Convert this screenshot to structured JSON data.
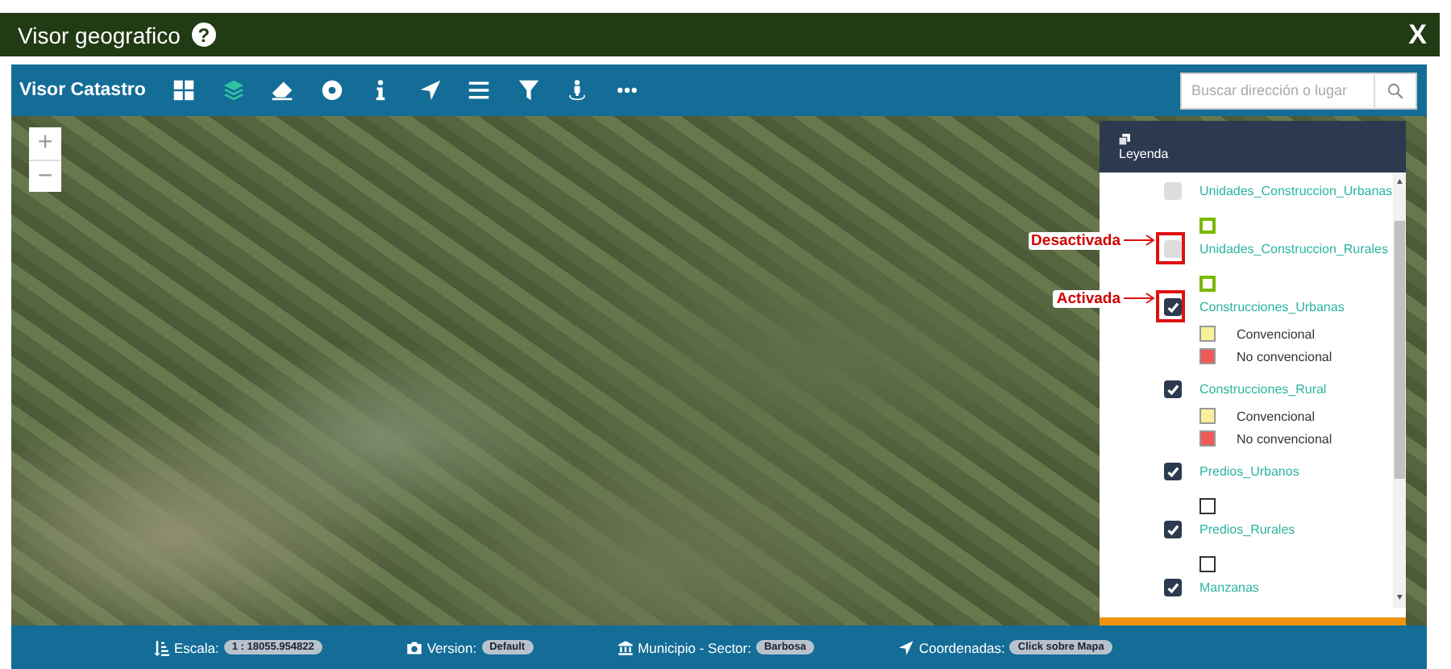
{
  "window": {
    "title": "Visor geografico",
    "help": "?",
    "close": "X"
  },
  "toolbar": {
    "title": "Visor Catastro",
    "tools": [
      {
        "kind": "grid",
        "selected": false
      },
      {
        "kind": "layers",
        "selected": true
      },
      {
        "kind": "eraser",
        "selected": false
      },
      {
        "kind": "target",
        "selected": false
      },
      {
        "kind": "info",
        "selected": false
      },
      {
        "kind": "navigate",
        "selected": false
      },
      {
        "kind": "list",
        "selected": false
      },
      {
        "kind": "filter",
        "selected": false
      },
      {
        "kind": "person",
        "selected": false
      },
      {
        "kind": "more",
        "selected": false
      }
    ],
    "search": {
      "placeholder": "Buscar dirección o lugar"
    }
  },
  "map": {
    "zoom_controls": [
      "+",
      "−"
    ]
  },
  "legend": {
    "title": "Leyenda",
    "entries": [
      {
        "kind": "layer",
        "name": "Unidades_Construccion_Urbanas",
        "checked": false
      },
      {
        "kind": "dashed-swatch"
      },
      {
        "kind": "layer",
        "name": "Unidades_Construccion_Rurales",
        "checked": false,
        "annotation": "Desactivada"
      },
      {
        "kind": "dashed-swatch"
      },
      {
        "kind": "layer",
        "name": "Construcciones_Urbanas",
        "checked": true,
        "annotation": "Activada"
      },
      {
        "kind": "class",
        "label": "Convencional",
        "color": "#f9f19a"
      },
      {
        "kind": "class",
        "label": "No convencional",
        "color": "#ef5a5a"
      },
      {
        "kind": "layer",
        "name": "Construcciones_Rural",
        "checked": true
      },
      {
        "kind": "class",
        "label": "Convencional",
        "color": "#f9f19a"
      },
      {
        "kind": "class",
        "label": "No convencional",
        "color": "#ef5a5a"
      },
      {
        "kind": "layer",
        "name": "Predios_Urbanos",
        "checked": true
      },
      {
        "kind": "outline-swatch"
      },
      {
        "kind": "layer",
        "name": "Predios_Rurales",
        "checked": true
      },
      {
        "kind": "outline-swatch"
      },
      {
        "kind": "layer",
        "name": "Manzanas",
        "checked": true
      }
    ]
  },
  "status_bar": [
    {
      "kind": "scale",
      "label": "Escala:",
      "value": "1 : 18055.954822"
    },
    {
      "kind": "camera",
      "label": "Version:",
      "value": "Default"
    },
    {
      "kind": "building",
      "label": "Municipio - Sector:",
      "value": "Barbosa"
    },
    {
      "kind": "navigate",
      "label": "Coordenadas:",
      "value": "Click sobre Mapa"
    }
  ]
}
